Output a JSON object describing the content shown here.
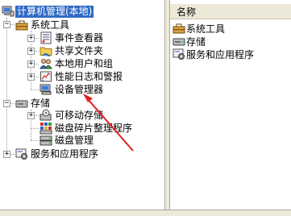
{
  "tree": {
    "root": {
      "label": "计算机管理(本地)",
      "icon": "computer-management-icon"
    },
    "system_tools": {
      "label": "系统工具",
      "icon": "toolbox-icon",
      "children": [
        {
          "label": "事件查看器",
          "icon": "event-viewer-icon"
        },
        {
          "label": "共享文件夹",
          "icon": "shared-folder-icon"
        },
        {
          "label": "本地用户和组",
          "icon": "users-group-icon"
        },
        {
          "label": "性能日志和警报",
          "icon": "performance-log-icon"
        },
        {
          "label": "设备管理器",
          "icon": "device-manager-icon"
        }
      ]
    },
    "storage": {
      "label": "存储",
      "icon": "storage-icon",
      "children": [
        {
          "label": "可移动存储",
          "icon": "removable-storage-icon"
        },
        {
          "label": "磁盘碎片整理程序",
          "icon": "defragmenter-icon"
        },
        {
          "label": "磁盘管理",
          "icon": "disk-management-icon"
        }
      ]
    },
    "services": {
      "label": "服务和应用程序",
      "icon": "services-apps-icon"
    }
  },
  "list": {
    "column_header": "名称",
    "items": [
      {
        "label": "系统工具",
        "icon": "toolbox-icon"
      },
      {
        "label": "存储",
        "icon": "storage-icon"
      },
      {
        "label": "服务和应用程序",
        "icon": "services-apps-icon"
      }
    ]
  },
  "colors": {
    "selection": "#316ac5",
    "annotation_arrow": "#e02020",
    "pane_chrome": "#ece9d8"
  }
}
